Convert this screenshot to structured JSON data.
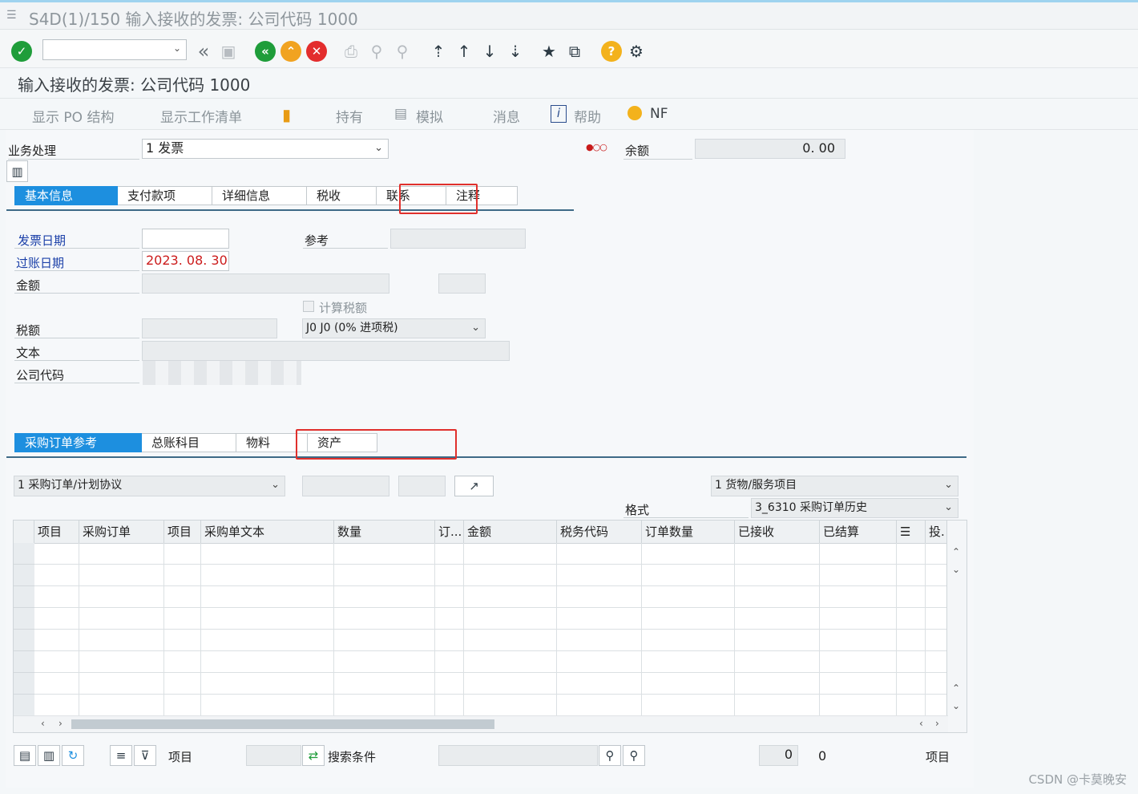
{
  "window": {
    "title": "S4D(1)/150 输入接收的发票: 公司代码 1000"
  },
  "toolbar": {
    "command_value": ""
  },
  "screen": {
    "title": "输入接收的发票: 公司代码 1000"
  },
  "app_toolbar": {
    "items": [
      "显示 PO 结构",
      "显示工作清单",
      "持有",
      "模拟",
      "消息",
      "帮助",
      "NF"
    ]
  },
  "header": {
    "transaction_label": "业务处理",
    "transaction_value": "1 发票",
    "balance_label": "余额",
    "balance_value": "0. 00"
  },
  "top_tabs": [
    "基本信息",
    "支付款项",
    "详细信息",
    "税收",
    "联系",
    "注释"
  ],
  "basic": {
    "invoice_date_label": "发票日期",
    "invoice_date_value": "",
    "reference_label": "参考",
    "posting_date_label": "过账日期",
    "posting_date_value": "2023. 08. 30",
    "amount_label": "金额",
    "calc_tax_label": "计算税额",
    "tax_amount_label": "税额",
    "tax_code_value": "J0 J0 (0% 进项税)",
    "text_label": "文本",
    "company_code_label": "公司代码"
  },
  "bottom_tabs": [
    "采购订单参考",
    "总账科目",
    "物料",
    "资产"
  ],
  "po_ref": {
    "ref_type_value": "1 采购订单/计划协议",
    "item_type_value": "1 货物/服务项目",
    "layout_label": "格式",
    "layout_value": "3_6310 采购订单历史"
  },
  "grid": {
    "columns": [
      "项目",
      "采购订单",
      "项目",
      "采购单文本",
      "数量",
      "订...",
      "金额",
      "税务代码",
      "订单数量",
      "已接收",
      "已结算",
      "",
      "投."
    ]
  },
  "footer": {
    "item_label": "项目",
    "search_label": "搜索条件",
    "count_value": "0",
    "count_text": "0",
    "items_text": "项目"
  },
  "watermark": "CSDN @卡莫晚安"
}
